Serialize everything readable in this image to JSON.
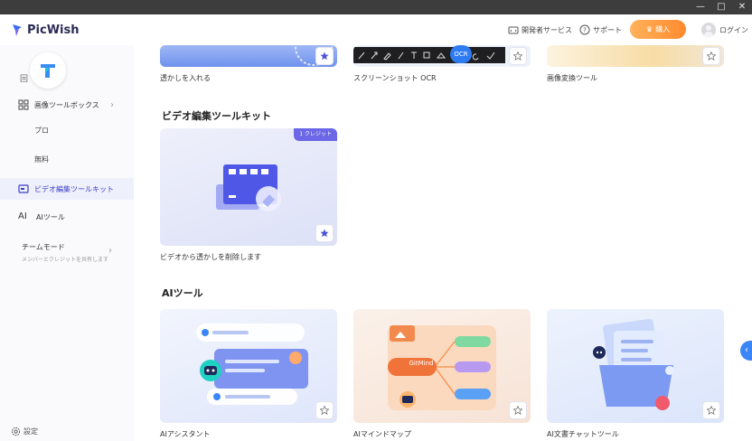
{
  "os": {
    "minimize": "—",
    "maximize": "□",
    "close": "✕"
  },
  "header": {
    "app_name": "PicWish",
    "developer_service": "開発者サービス",
    "support": "サポート",
    "buy": "購入",
    "login": "ログイン"
  },
  "sidebar": {
    "image_toolbox": "画像ツールボックス",
    "pro": "プロ",
    "free": "無料",
    "video_toolkit": "ビデオ編集ツールキット",
    "ai_tools": "AIツール",
    "team_mode": "チームモード",
    "team_mode_sub": "メンバーとクレジットを共有します",
    "settings": "設定"
  },
  "top_cards": [
    {
      "caption": "透かしを入れる"
    },
    {
      "caption": "スクリーンショット OCR",
      "ocr_badge": "OCR"
    },
    {
      "caption": "画像変換ツール"
    }
  ],
  "video_section": {
    "title": "ビデオ編集ツールキット",
    "card_caption": "ビデオから透かしを削除します",
    "credit_badge": "1 クレジット"
  },
  "ai_section": {
    "title": "AIツール",
    "cards": [
      {
        "caption": "AIアシスタント"
      },
      {
        "caption": "AIマインドマップ",
        "inner_label": "GitMind"
      },
      {
        "caption": "AI文書チャットツール"
      }
    ]
  },
  "colors": {
    "accent": "#3b3ec9",
    "buy_start": "#ffb25a",
    "buy_end": "#ff8a2e",
    "credit": "#6b67e6"
  }
}
